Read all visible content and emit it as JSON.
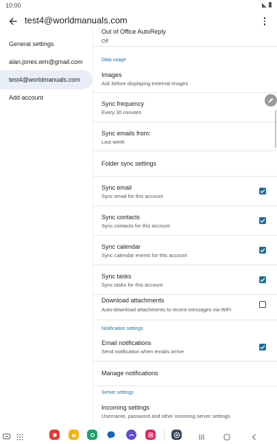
{
  "status": {
    "time": "10:00"
  },
  "app_bar": {
    "title": "test4@worldmanuals.com"
  },
  "sidebar": {
    "items": [
      {
        "label": "General settings"
      },
      {
        "label": "alan.jones.wm@gmail.com"
      },
      {
        "label": "test4@worldmanuals.com",
        "selected": true
      },
      {
        "label": "Add account"
      }
    ]
  },
  "content": {
    "out_of_office": {
      "title": "Out of Office AutoReply",
      "sub": "Off"
    },
    "sections": {
      "data_usage": "Data usage",
      "notification": "Notification settings",
      "server": "Server settings"
    },
    "images": {
      "title": "Images",
      "sub": "Ask before displaying external images"
    },
    "sync_frequency": {
      "title": "Sync frequency",
      "sub": "Every 30 minutes"
    },
    "sync_from": {
      "title": "Sync emails from:",
      "sub": "Last week"
    },
    "folder_sync": {
      "title": "Folder sync settings"
    },
    "sync_email": {
      "title": "Sync email",
      "sub": "Sync email for this account",
      "checked": true
    },
    "sync_contacts": {
      "title": "Sync contacts",
      "sub": "Sync contacts for this account",
      "checked": true
    },
    "sync_calendar": {
      "title": "Sync calendar",
      "sub": "Sync calendar events for this account",
      "checked": true
    },
    "sync_tasks": {
      "title": "Sync tasks",
      "sub": "Sync tasks for this account",
      "checked": true
    },
    "download_attachments": {
      "title": "Download attachments",
      "sub": "Auto-download attachments to recent messages via WiFi",
      "checked": false
    },
    "email_notifications": {
      "title": "Email notifications",
      "sub": "Send notification when emails arrive",
      "checked": true
    },
    "manage_notifications": {
      "title": "Manage notifications"
    },
    "incoming_settings": {
      "title": "Incoming settings",
      "sub": "Username, password and other incoming server settings"
    }
  },
  "colors": {
    "accent": "#1b6e9e",
    "section": "#1a73a8",
    "selected_bg": "#e8eef7"
  },
  "dock_icons": [
    "keyboard-icon",
    "apps-grid-icon",
    "app-red-icon",
    "app-yellow-icon",
    "app-green-icon",
    "chat-icon",
    "app-purple-icon",
    "app-pink-icon",
    "settings-icon"
  ],
  "nav_icons": [
    "recents-icon",
    "home-icon",
    "back-icon"
  ]
}
